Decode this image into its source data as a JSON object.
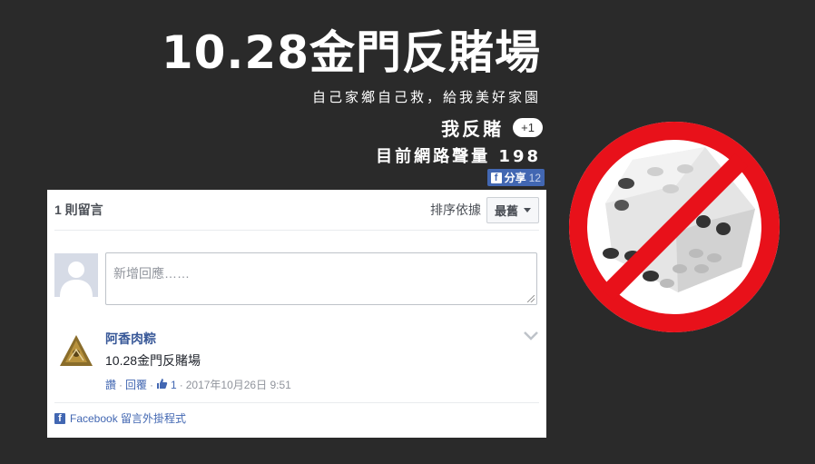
{
  "header": {
    "title": "10.28金門反賭場",
    "subtitle": "自己家鄉自己救，給我美好家園",
    "oppose_label": "我反賭",
    "plus_one": "+1",
    "count_text": "目前網路聲量 198",
    "share_label": "分享",
    "share_count": "12",
    "share_icon": "f"
  },
  "comments": {
    "count_label": "1 則留言",
    "sort_label": "排序依據",
    "sort_selected": "最舊",
    "composer_placeholder": "新增回應……",
    "items": [
      {
        "author": "阿香肉粽",
        "text": "10.28金門反賭場",
        "like_label": "讚",
        "reply_label": "回覆",
        "likes": "1",
        "timestamp": "2017年10月26日 9:51"
      }
    ],
    "footer_label": "Facebook 留言外掛程式",
    "footer_icon": "f"
  },
  "colors": {
    "background": "#2a2a2a",
    "facebook_blue": "#4267b2",
    "name_blue": "#385898",
    "prohibition_red": "#e8111a"
  },
  "icons": [
    "share-facebook-icon",
    "thumbs-up-icon",
    "chevron-down-icon",
    "facebook-icon",
    "no-gambling-icon"
  ]
}
